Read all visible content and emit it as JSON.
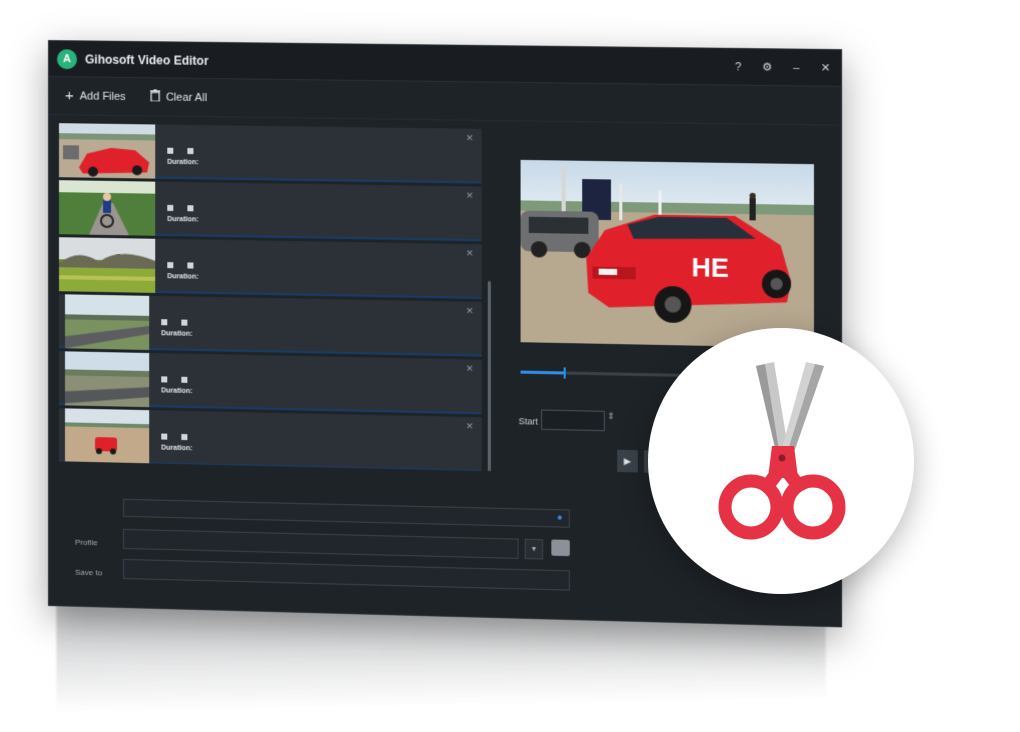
{
  "titlebar": {
    "logo_letter": "A",
    "app_title": "Gihosoft Video Editor",
    "version": "",
    "controls": [
      "?",
      "⚙",
      "–",
      "✕"
    ]
  },
  "toolbar": {
    "add_files_label": "Add Files",
    "clear_all_label": "Clear All"
  },
  "files": [
    {
      "name": "",
      "info_a": "",
      "info_b": "",
      "duration_label": "Duration:",
      "duration": "",
      "scene": "red-car"
    },
    {
      "name": "",
      "info_a": "",
      "info_b": "",
      "duration_label": "Duration:",
      "duration": "",
      "scene": "cyclist"
    },
    {
      "name": "",
      "info_a": "",
      "info_b": "",
      "duration_label": "Duration:",
      "duration": "",
      "scene": "field"
    },
    {
      "name": "",
      "info_a": "",
      "info_b": "",
      "duration_label": "Duration:",
      "duration": "",
      "scene": "road"
    },
    {
      "name": "",
      "info_a": "",
      "info_b": "",
      "duration_label": "Duration:",
      "duration": "",
      "scene": "road2"
    },
    {
      "name": "",
      "info_a": "",
      "info_b": "",
      "duration_label": "Duration:",
      "duration": "",
      "scene": "red-car-small"
    }
  ],
  "preview": {
    "timeline_time": "",
    "progress": 0.15,
    "start_label": "Start",
    "start_value": "",
    "end_label": "",
    "play_icon": "play-icon",
    "stop_icon": "stop-icon"
  },
  "bottom": {
    "total_text": "",
    "profile_label": "Profile",
    "profile_a": "",
    "profile_b": "",
    "saveto_label": "Save to",
    "saveto_path": ""
  },
  "icons": {
    "add": "plus-icon",
    "clear": "trash-icon",
    "search": "search-icon",
    "folder": "folder-icon",
    "badge": "scissors-icon"
  },
  "colors": {
    "window_bg": "#1e2328",
    "row_bg": "#2b3137",
    "accent_blue": "#2f8ee8",
    "scissors_red": "#e53345",
    "logo_green": "#2ab37d"
  }
}
